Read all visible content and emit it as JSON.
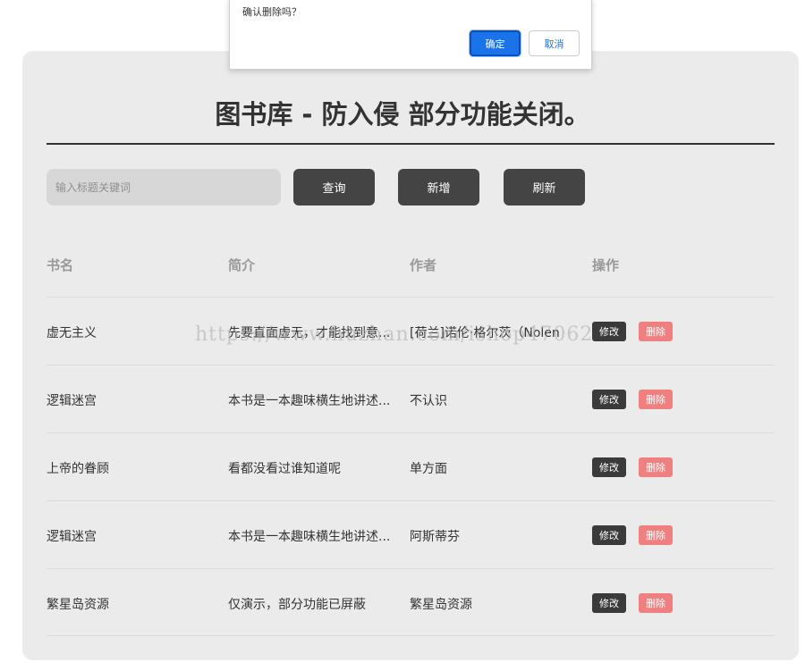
{
  "dialog": {
    "message": "确认删除吗？",
    "ok_label": "确定",
    "cancel_label": "取消"
  },
  "page": {
    "title": "图书库 - 防入侵 部分功能关闭。"
  },
  "toolbar": {
    "search_placeholder": "输入标题关键词",
    "query_label": "查询",
    "add_label": "新增",
    "refresh_label": "刷新"
  },
  "table": {
    "headers": [
      "书名",
      "简介",
      "作者",
      "操作"
    ],
    "rows": [
      {
        "name": "虚无主义",
        "intro": "先要直面虚无，才能找到意...",
        "author": "[荷兰]诺伦·格尔茨（Nolen"
      },
      {
        "name": "逻辑迷宫",
        "intro": "本书是一本趣味横生地讲述...",
        "author": "不认识"
      },
      {
        "name": "上帝的眷顾",
        "intro": "看都没看过谁知道呢",
        "author": "单方面"
      },
      {
        "name": "逻辑迷宫",
        "intro": "本书是一本趣味横生地讲述...",
        "author": "阿斯蒂芬"
      },
      {
        "name": "繁星岛资源",
        "intro": "仅演示，部分功能已屏蔽",
        "author": "繁星岛资源"
      }
    ],
    "edit_label": "修改",
    "delete_label": "删除"
  },
  "watermark": "https://www.huzhan.com/ishop47062"
}
